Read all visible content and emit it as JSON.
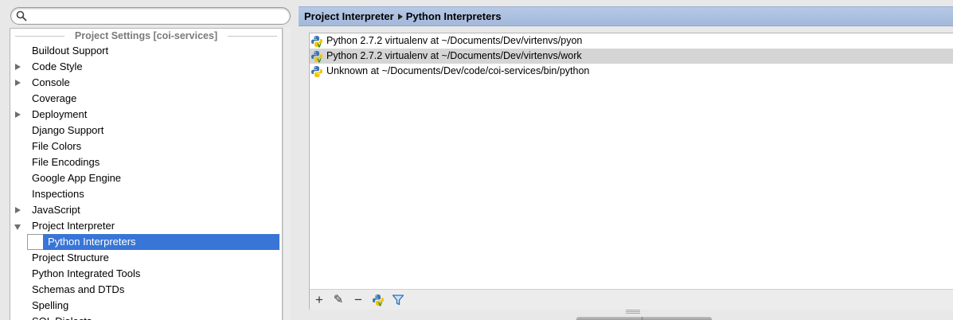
{
  "search": {
    "value": "",
    "placeholder": ""
  },
  "tree": {
    "header": "Project Settings [coi-services]",
    "items": [
      {
        "label": "Buildout Support",
        "expandable": false
      },
      {
        "label": "Code Style",
        "expandable": true
      },
      {
        "label": "Console",
        "expandable": true
      },
      {
        "label": "Coverage",
        "expandable": false
      },
      {
        "label": "Deployment",
        "expandable": true
      },
      {
        "label": "Django Support",
        "expandable": false
      },
      {
        "label": "File Colors",
        "expandable": false
      },
      {
        "label": "File Encodings",
        "expandable": false
      },
      {
        "label": "Google App Engine",
        "expandable": false
      },
      {
        "label": "Inspections",
        "expandable": false
      },
      {
        "label": "JavaScript",
        "expandable": true
      },
      {
        "label": "Project Interpreter",
        "expandable": true,
        "expanded": true
      },
      {
        "label": "Python Interpreters",
        "child": true,
        "selected": true
      },
      {
        "label": "Project Structure",
        "expandable": false
      },
      {
        "label": "Python Integrated Tools",
        "expandable": false
      },
      {
        "label": "Schemas and DTDs",
        "expandable": false
      },
      {
        "label": "Spelling",
        "expandable": false
      },
      {
        "label": "SQL Dialects",
        "expandable": false
      }
    ]
  },
  "breadcrumb": {
    "parent": "Project Interpreter",
    "current": "Python Interpreters"
  },
  "interpreters": [
    {
      "label": "Python 2.7.2 virtualenv at ~/Documents/Dev/virtenvs/pyon",
      "icon": "python-virtualenv-icon",
      "highlighted": false
    },
    {
      "label": "Python 2.7.2 virtualenv at ~/Documents/Dev/virtenvs/work",
      "icon": "python-virtualenv-icon",
      "highlighted": true
    },
    {
      "label": "Unknown at ~/Documents/Dev/code/coi-services/bin/python",
      "icon": "python-icon",
      "highlighted": false
    }
  ],
  "toolbar": {
    "add": "+",
    "edit": "✎",
    "remove": "−",
    "virtualenv": "python-virtualenv-icon",
    "filter": "filter-icon"
  },
  "colors": {
    "selection": "#3875d7",
    "header_bg": "#a9bddf",
    "highlight_row": "#d5d5d5"
  }
}
